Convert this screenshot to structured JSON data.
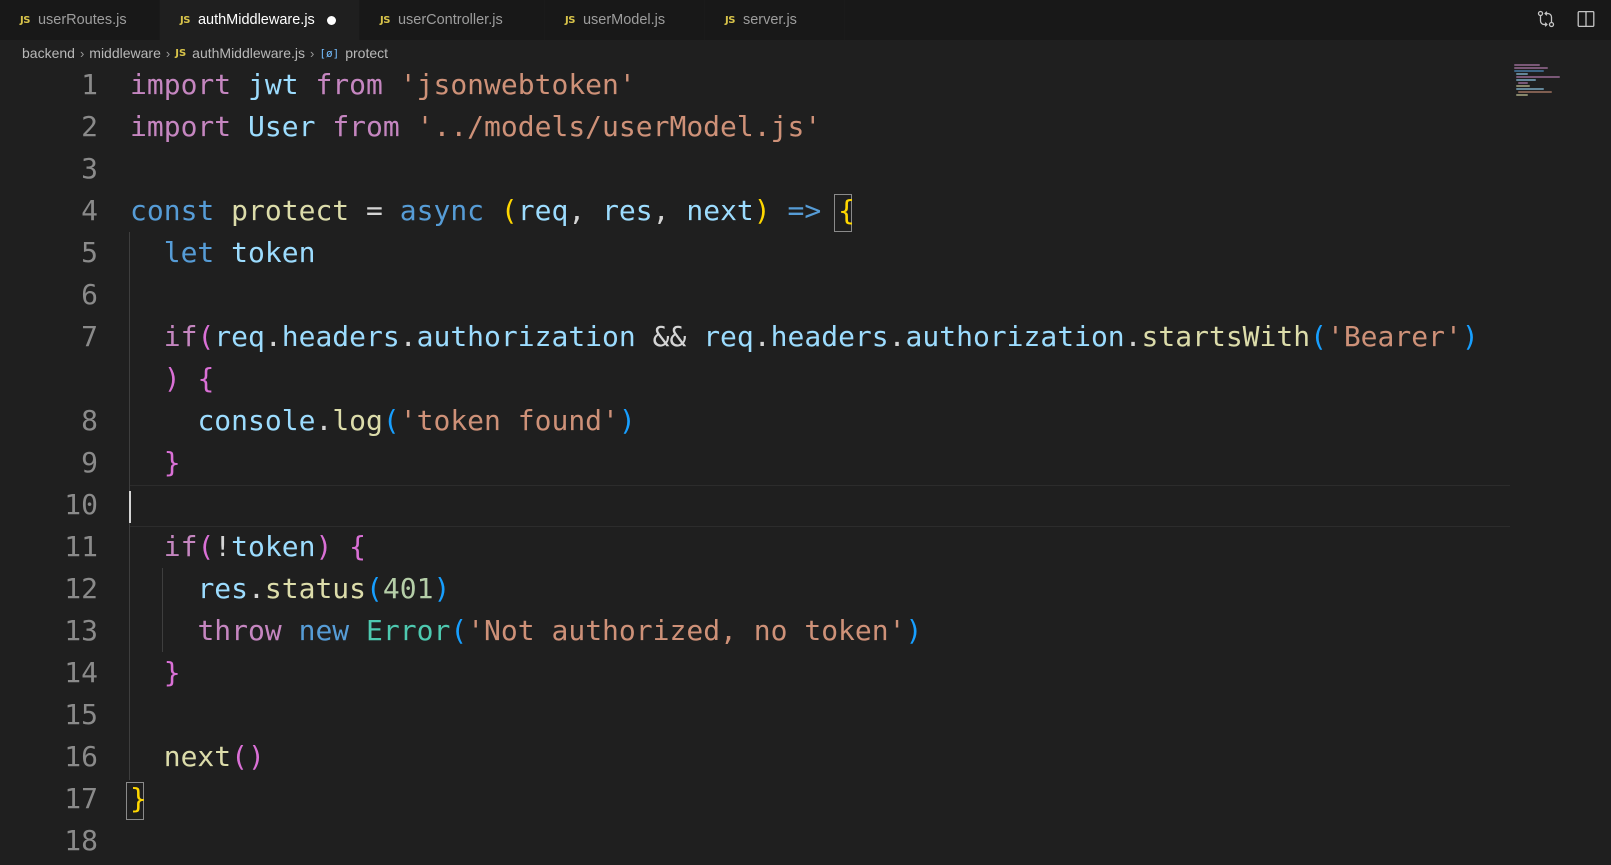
{
  "tabs": [
    {
      "label": "userRoutes.js",
      "icon": "JS",
      "active": false
    },
    {
      "label": "authMiddleware.js",
      "icon": "JS",
      "active": true,
      "modified": true
    },
    {
      "label": "userController.js",
      "icon": "JS",
      "active": false
    },
    {
      "label": "userModel.js",
      "icon": "JS",
      "active": false
    },
    {
      "label": "server.js",
      "icon": "JS",
      "active": false
    }
  ],
  "tab_actions": [
    {
      "icon": "source-control-compare-icon"
    },
    {
      "icon": "split-editor-icon"
    }
  ],
  "breadcrumb": {
    "folder1": "backend",
    "folder2": "middleware",
    "file_icon": "JS",
    "file": "authMiddleware.js",
    "symbol_icon": "[ø]",
    "symbol": "protect"
  },
  "editor": {
    "line_numbers": [
      "1",
      "2",
      "3",
      "4",
      "5",
      "6",
      "7",
      "8",
      "9",
      "10",
      "11",
      "12",
      "13",
      "14",
      "15",
      "16",
      "17",
      "18"
    ],
    "lines": [
      [
        [
          "k",
          "import"
        ],
        [
          "p",
          " "
        ],
        [
          "v",
          "jwt"
        ],
        [
          "p",
          " "
        ],
        [
          "k",
          "from"
        ],
        [
          "p",
          " "
        ],
        [
          "s",
          "'jsonwebtoken'"
        ]
      ],
      [
        [
          "k",
          "import"
        ],
        [
          "p",
          " "
        ],
        [
          "v",
          "User"
        ],
        [
          "p",
          " "
        ],
        [
          "k",
          "from"
        ],
        [
          "p",
          " "
        ],
        [
          "s",
          "'../models/userModel.js'"
        ]
      ],
      [],
      [
        [
          "b",
          "const"
        ],
        [
          "p",
          " "
        ],
        [
          "f",
          "protect"
        ],
        [
          "p",
          " = "
        ],
        [
          "b",
          "async"
        ],
        [
          "p",
          " "
        ],
        [
          "y",
          "("
        ],
        [
          "v",
          "req"
        ],
        [
          "p",
          ", "
        ],
        [
          "v",
          "res"
        ],
        [
          "p",
          ", "
        ],
        [
          "v",
          "next"
        ],
        [
          "y",
          ")"
        ],
        [
          "p",
          " "
        ],
        [
          "b",
          "=>"
        ],
        [
          "p",
          " "
        ],
        [
          "y",
          "{"
        ]
      ],
      [
        [
          "p",
          "  "
        ],
        [
          "b",
          "let"
        ],
        [
          "p",
          " "
        ],
        [
          "v",
          "token"
        ]
      ],
      [],
      [
        [
          "p",
          "  "
        ],
        [
          "k",
          "if"
        ],
        [
          "m",
          "("
        ],
        [
          "v",
          "req"
        ],
        [
          "p",
          "."
        ],
        [
          "v",
          "headers"
        ],
        [
          "p",
          "."
        ],
        [
          "v",
          "authorization"
        ],
        [
          "p",
          " && "
        ],
        [
          "v",
          "req"
        ],
        [
          "p",
          "."
        ],
        [
          "v",
          "headers"
        ],
        [
          "p",
          "."
        ],
        [
          "v",
          "authorization"
        ],
        [
          "p",
          "."
        ],
        [
          "f",
          "startsWith"
        ],
        [
          "bl",
          "("
        ],
        [
          "s",
          "'Bearer'"
        ],
        [
          "bl",
          ")"
        ]
      ],
      [
        [
          "p",
          "  "
        ],
        [
          "m",
          ")"
        ],
        [
          "p",
          " "
        ],
        [
          "m",
          "{"
        ]
      ],
      [
        [
          "p",
          "    "
        ],
        [
          "v",
          "console"
        ],
        [
          "p",
          "."
        ],
        [
          "f",
          "log"
        ],
        [
          "bl",
          "("
        ],
        [
          "s",
          "'token found'"
        ],
        [
          "bl",
          ")"
        ]
      ],
      [
        [
          "p",
          "  "
        ],
        [
          "m",
          "}"
        ]
      ],
      [],
      [
        [
          "p",
          "  "
        ],
        [
          "k",
          "if"
        ],
        [
          "m",
          "("
        ],
        [
          "p",
          "!"
        ],
        [
          "v",
          "token"
        ],
        [
          "m",
          ")"
        ],
        [
          "p",
          " "
        ],
        [
          "m",
          "{"
        ]
      ],
      [
        [
          "p",
          "    "
        ],
        [
          "v",
          "res"
        ],
        [
          "p",
          "."
        ],
        [
          "f",
          "status"
        ],
        [
          "bl",
          "("
        ],
        [
          "n",
          "401"
        ],
        [
          "bl",
          ")"
        ]
      ],
      [
        [
          "p",
          "    "
        ],
        [
          "k",
          "throw"
        ],
        [
          "p",
          " "
        ],
        [
          "b",
          "new"
        ],
        [
          "p",
          " "
        ],
        [
          "t",
          "Error"
        ],
        [
          "bl",
          "("
        ],
        [
          "s",
          "'Not authorized, no token'"
        ],
        [
          "bl",
          ")"
        ]
      ],
      [
        [
          "p",
          "  "
        ],
        [
          "m",
          "}"
        ]
      ],
      [],
      [
        [
          "p",
          "  "
        ],
        [
          "f",
          "next"
        ],
        [
          "m",
          "()"
        ]
      ],
      [
        [
          "y",
          "}"
        ]
      ],
      []
    ]
  },
  "colors": {
    "editor_bg": "#1f1f1f",
    "tabbar_bg": "#181818",
    "keyword": "#c586c0",
    "storage": "#569cd6",
    "variable": "#9cdcfe",
    "function": "#dcdcaa",
    "string": "#ce9178",
    "class": "#4ec9b0",
    "number": "#b5cea8",
    "js_badge": "#d9c44a"
  }
}
